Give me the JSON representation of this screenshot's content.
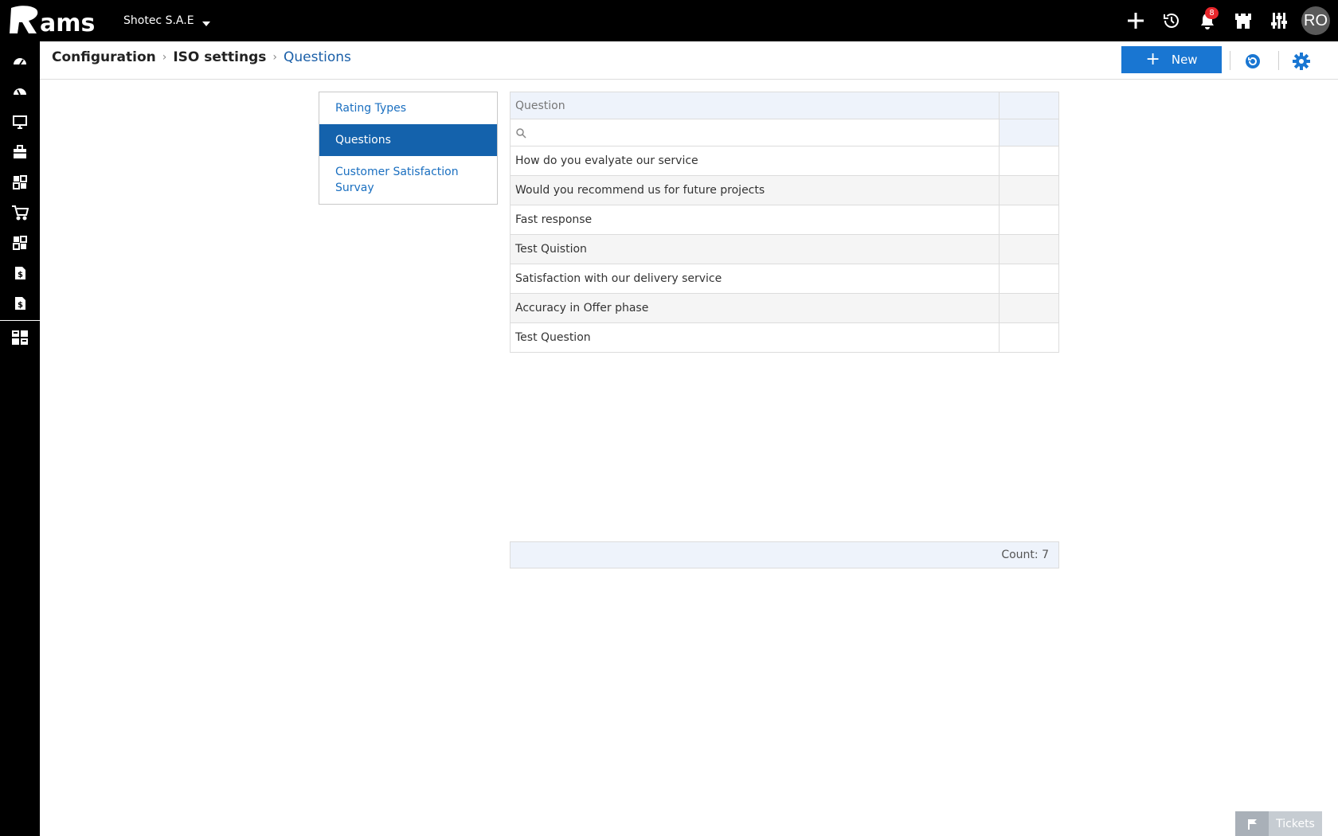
{
  "app": {
    "logo_text": "Rams",
    "company": "Shotec S.A.E"
  },
  "topbar": {
    "icons": [
      "add-icon",
      "history-icon",
      "bell-icon",
      "castle-icon",
      "sliders-icon"
    ],
    "notification_count": "8",
    "avatar_initials": "RO"
  },
  "sidebar": {
    "items": [
      "dashboard-icon",
      "dashboard-alt-icon",
      "monitor-icon",
      "briefcase-icon",
      "modules-icon",
      "cart-icon",
      "modules-alt-icon",
      "invoice-icon",
      "invoice-alt-icon",
      "grid-icon"
    ]
  },
  "breadcrumb": {
    "items": [
      "Configuration",
      "ISO settings",
      "Questions"
    ]
  },
  "toolbar": {
    "new_label": "New"
  },
  "nav": {
    "items": [
      {
        "label": "Rating Types",
        "selected": false
      },
      {
        "label": "Questions",
        "selected": true
      },
      {
        "label": "Customer Satisfaction Survay",
        "selected": false
      }
    ]
  },
  "grid": {
    "column_header": "Question",
    "filter_value": "",
    "rows": [
      "How do you evalyate our service",
      "Would you recommend us for future projects",
      "Fast response",
      "Test Quistion",
      "Satisfaction with our delivery service",
      "Accuracy in Offer phase",
      "Test Question"
    ],
    "count_label": "Count: 7"
  },
  "tickets": {
    "label": "Tickets"
  },
  "colors": {
    "accent": "#1976d2",
    "selected_nav": "#1462ac",
    "link": "#1a6fc0",
    "badge": "#e8262b"
  }
}
